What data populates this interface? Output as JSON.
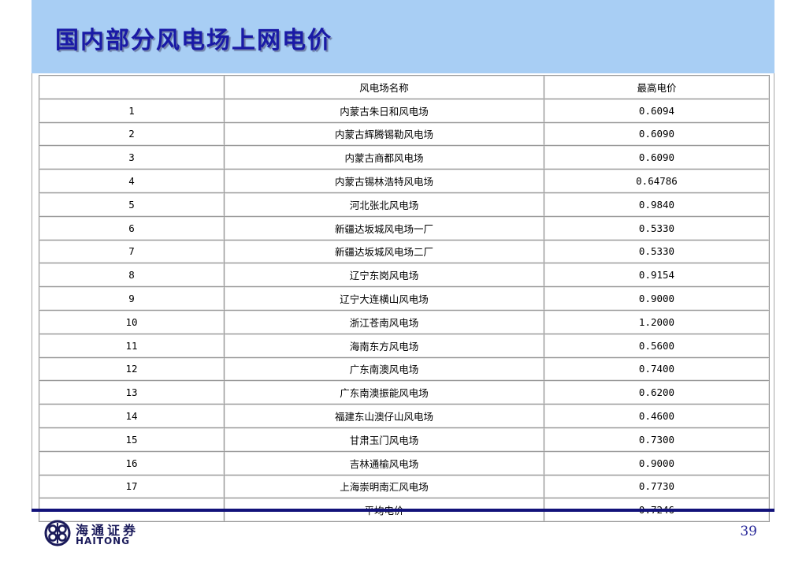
{
  "slide": {
    "title": "国内部分风电场上网电价",
    "page_number": "39"
  },
  "logo": {
    "chinese": "海通证券",
    "english": "HAITONG"
  },
  "table": {
    "headers": [
      "",
      "风电场名称",
      "最高电价"
    ],
    "rows": [
      [
        "1",
        "内蒙古朱日和风电场",
        "0.6094"
      ],
      [
        "2",
        "内蒙古辉腾锡勒风电场",
        "0.6090"
      ],
      [
        "3",
        "内蒙古商都风电场",
        "0.6090"
      ],
      [
        "4",
        "内蒙古锡林浩特风电场",
        "0.64786"
      ],
      [
        "5",
        "河北张北风电场",
        "0.9840"
      ],
      [
        "6",
        "新疆达坂城风电场一厂",
        "0.5330"
      ],
      [
        "7",
        "新疆达坂城风电场二厂",
        "0.5330"
      ],
      [
        "8",
        "辽宁东岗风电场",
        "0.9154"
      ],
      [
        "9",
        "辽宁大连横山风电场",
        "0.9000"
      ],
      [
        "10",
        "浙江苍南风电场",
        "1.2000"
      ],
      [
        "11",
        "海南东方风电场",
        "0.5600"
      ],
      [
        "12",
        "广东南澳风电场",
        "0.7400"
      ],
      [
        "13",
        "广东南澳振能风电场",
        "0.6200"
      ],
      [
        "14",
        "福建东山澳仔山风电场",
        "0.4600"
      ],
      [
        "15",
        "甘肃玉门风电场",
        "0.7300"
      ],
      [
        "16",
        "吉林通榆风电场",
        "0.9000"
      ],
      [
        "17",
        "上海崇明南汇风电场",
        "0.7730"
      ],
      [
        "",
        "平均电价",
        "0.7246"
      ]
    ]
  }
}
